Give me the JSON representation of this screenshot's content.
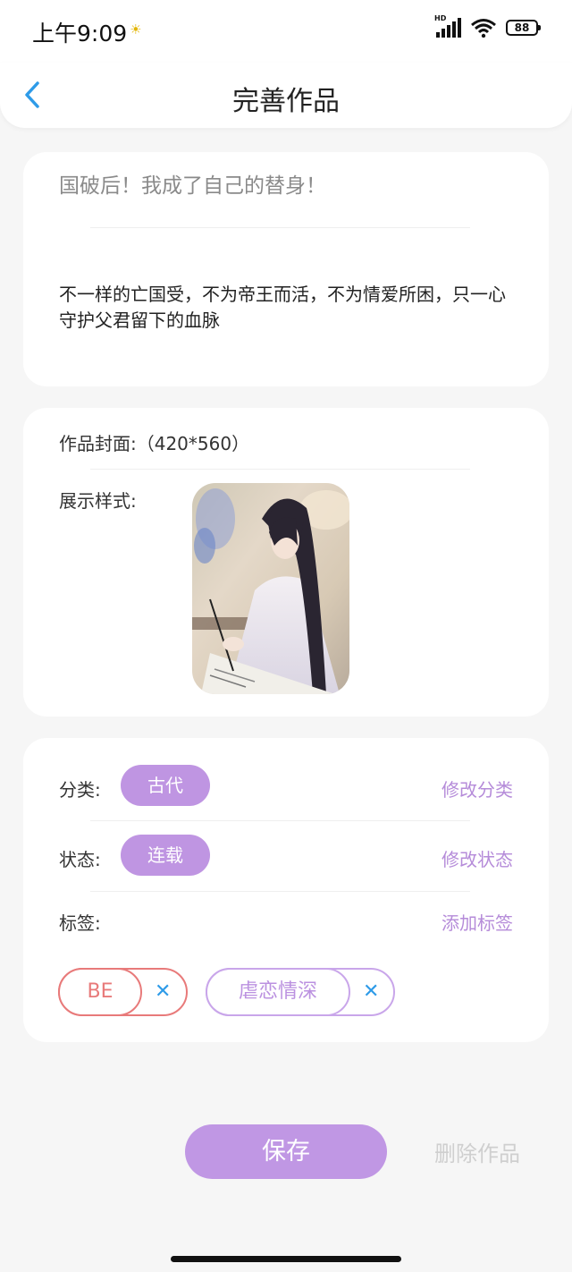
{
  "status_bar": {
    "time": "上午9:09",
    "hd": "HD",
    "battery": "88"
  },
  "nav": {
    "title": "完善作品"
  },
  "work": {
    "title": "国破后！我成了自己的替身！",
    "description": "不一样的亡国受，不为帝王而活，不为情爱所困，只一心守护父君留下的血脉"
  },
  "cover": {
    "label": "作品封面:（420*560）",
    "style_label": "展示样式:"
  },
  "meta": {
    "category_label": "分类:",
    "category_value": "古代",
    "category_action": "修改分类",
    "status_label": "状态:",
    "status_value": "连载",
    "status_action": "修改状态",
    "tags_label": "标签:",
    "tags_action": "添加标签",
    "tags": [
      {
        "text": "BE",
        "remove": "✕"
      },
      {
        "text": "虐恋情深",
        "remove": "✕"
      }
    ]
  },
  "footer": {
    "save_label": "保存",
    "delete_label": "删除作品"
  },
  "colors": {
    "accent": "#c097e4",
    "tag_red": "#e87a7a",
    "remove_blue": "#2e9be8",
    "back_blue": "#2e9be8"
  }
}
